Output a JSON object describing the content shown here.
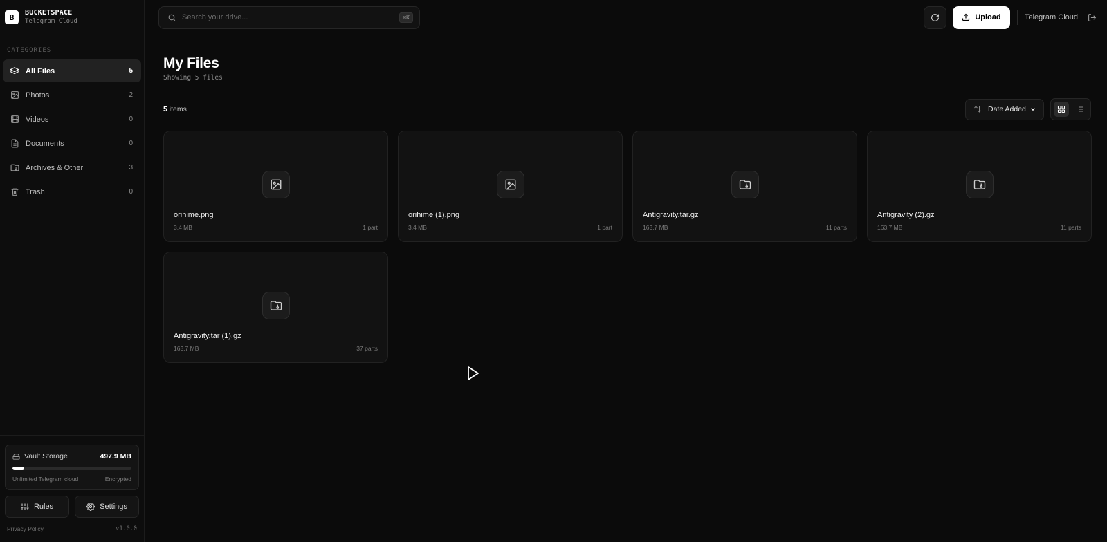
{
  "brand": {
    "logo": "B",
    "name": "BUCKETSPACE",
    "subtitle": "Telegram Cloud"
  },
  "sidebar": {
    "categories_label": "CATEGORIES",
    "items": [
      {
        "label": "All Files",
        "count": "5",
        "icon": "layers-icon",
        "active": true
      },
      {
        "label": "Photos",
        "count": "2",
        "icon": "image-icon"
      },
      {
        "label": "Videos",
        "count": "0",
        "icon": "film-icon"
      },
      {
        "label": "Documents",
        "count": "0",
        "icon": "document-icon"
      },
      {
        "label": "Archives & Other",
        "count": "3",
        "icon": "folder-archive-icon"
      },
      {
        "label": "Trash",
        "count": "0",
        "icon": "trash-icon"
      }
    ],
    "vault": {
      "title": "Vault Storage",
      "size": "497.9 MB",
      "usage_fraction": 0.1,
      "left_note": "Unlimited Telegram cloud",
      "right_note": "Encrypted"
    },
    "rules_label": "Rules",
    "settings_label": "Settings",
    "privacy_label": "Privacy Policy",
    "version": "v1.0.0"
  },
  "topbar": {
    "search_placeholder": "Search your drive...",
    "shortcut": "⌘K",
    "upload_label": "Upload",
    "cloud_label": "Telegram Cloud"
  },
  "main": {
    "title": "My Files",
    "subtitle": "Showing 5 files",
    "items_count": "5",
    "items_suffix": " items",
    "sort_label": "Date Added",
    "files": [
      {
        "name": "orihime.png",
        "size": "3.4 MB",
        "parts": "1 part",
        "icon": "image-icon"
      },
      {
        "name": "orihime (1).png",
        "size": "3.4 MB",
        "parts": "1 part",
        "icon": "image-icon"
      },
      {
        "name": "Antigravity.tar.gz",
        "size": "163.7 MB",
        "parts": "11 parts",
        "icon": "folder-archive-icon"
      },
      {
        "name": "Antigravity (2).gz",
        "size": "163.7 MB",
        "parts": "11 parts",
        "icon": "folder-archive-icon"
      },
      {
        "name": "Antigravity.tar (1).gz",
        "size": "163.7 MB",
        "parts": "37 parts",
        "icon": "folder-archive-icon"
      }
    ]
  },
  "colors": {
    "background": "#0b0b0b",
    "panel": "#121212",
    "accent": "#ffffff",
    "muted": "#7a7a7a"
  }
}
